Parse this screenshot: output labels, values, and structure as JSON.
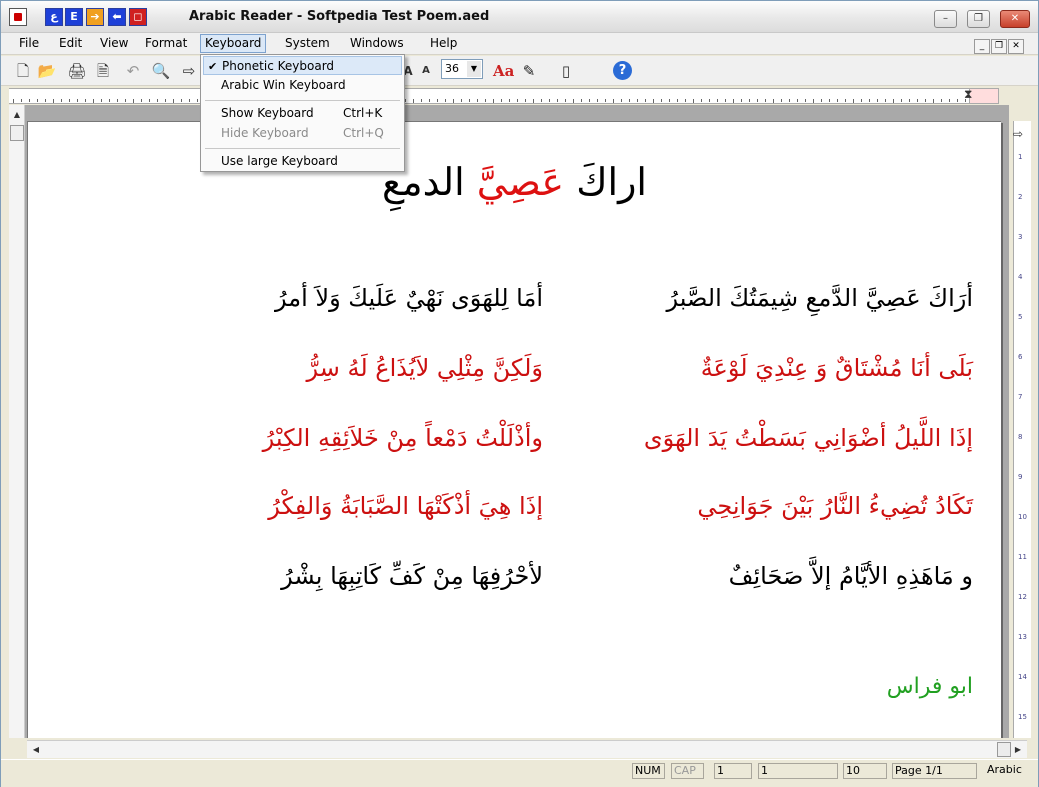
{
  "window": {
    "title": "Arabic Reader - Softpedia Test Poem.aed",
    "quick_buttons": [
      "ع",
      "E",
      "➔",
      "⬅",
      "◻"
    ],
    "controls": {
      "minimize": "–",
      "restore": "❐",
      "close": "✕"
    }
  },
  "menubar": {
    "items": [
      "File",
      "Edit",
      "View",
      "Format",
      "Keyboard",
      "System",
      "Windows",
      "Help"
    ],
    "active": "Keyboard",
    "mdi_buttons": [
      "_",
      "❐",
      "✕"
    ]
  },
  "toolbar": {
    "font_size": "36",
    "icons": [
      "new-icon",
      "open-icon",
      "print-icon",
      "print-preview-icon",
      "undo-icon",
      "find-icon",
      "arrow-icon",
      "font-grow-icon",
      "font-shrink-icon",
      "font-color-icon",
      "highlight-icon",
      "page-icon",
      "help-icon"
    ]
  },
  "keyboard_menu": {
    "items": [
      {
        "label": "Phonetic Keyboard",
        "shortcut": "",
        "checked": true,
        "selected": true,
        "disabled": false
      },
      {
        "label": "Arabic Win Keyboard",
        "shortcut": "",
        "checked": false,
        "selected": false,
        "disabled": false
      },
      {
        "label": "Show Keyboard",
        "shortcut": "Ctrl+K",
        "checked": false,
        "selected": false,
        "disabled": false
      },
      {
        "label": "Hide Keyboard",
        "shortcut": "Ctrl+Q",
        "checked": false,
        "selected": false,
        "disabled": true
      },
      {
        "label": "Use large Keyboard",
        "shortcut": "",
        "checked": false,
        "selected": false,
        "disabled": false
      }
    ]
  },
  "document": {
    "title_black": "اراكَ",
    "title_red": "عَصِيَّ",
    "title_rest": "الدمعِ",
    "lines": [
      {
        "color": "black",
        "first": "أرَاكَ عَصِيَّ الدَّمعِ شِيمَتُكَ الصَّبرُ",
        "second": "أمَا لِلهَوَى نَهْيٌ عَلَيكَ وَلاَ أمرُ"
      },
      {
        "color": "red",
        "first": "بَلَى أنَا مُشْتَاقٌ وَ عِنْدِيَ لَوْعَةٌ",
        "second": "وَلَكِنَّ مِثْلِي لاَيُذَاعُ لَهُ سِرُّ"
      },
      {
        "color": "red",
        "first": "إذَا اللَّيلُ أضْوَانِي بَسَطْتُ يَدَ الهَوَى",
        "second": "وأذْلَلْتُ دَمْعاً مِنْ خَلاَئِقِهِ الكِبْرُ"
      },
      {
        "color": "red",
        "first": "تَكَادُ تُضِيءُ النَّارُ بَيْنَ جَوَانِحِي",
        "second": "إذَا هِيَ أذْكَتْهَا الصَّبَابَةُ وَالفِكْرُ"
      },
      {
        "color": "black",
        "first": "و مَاهَذِهِ الأيَّامُ إلاَّ صَحَائِفٌ",
        "second": "لأحْرُفِهَا مِنْ كَفِّ كَاتِبِهَا بِشْرُ"
      }
    ],
    "author": "ابو فراس"
  },
  "statusbar": {
    "num": "NUM",
    "cap": "CAP",
    "line": "1",
    "col": "1",
    "size": "10",
    "page": "Page 1/1",
    "language": "Arabic"
  },
  "colors": {
    "accent": "#cc1010",
    "author": "#21a021",
    "menu_highlight": "#dce9f8"
  }
}
